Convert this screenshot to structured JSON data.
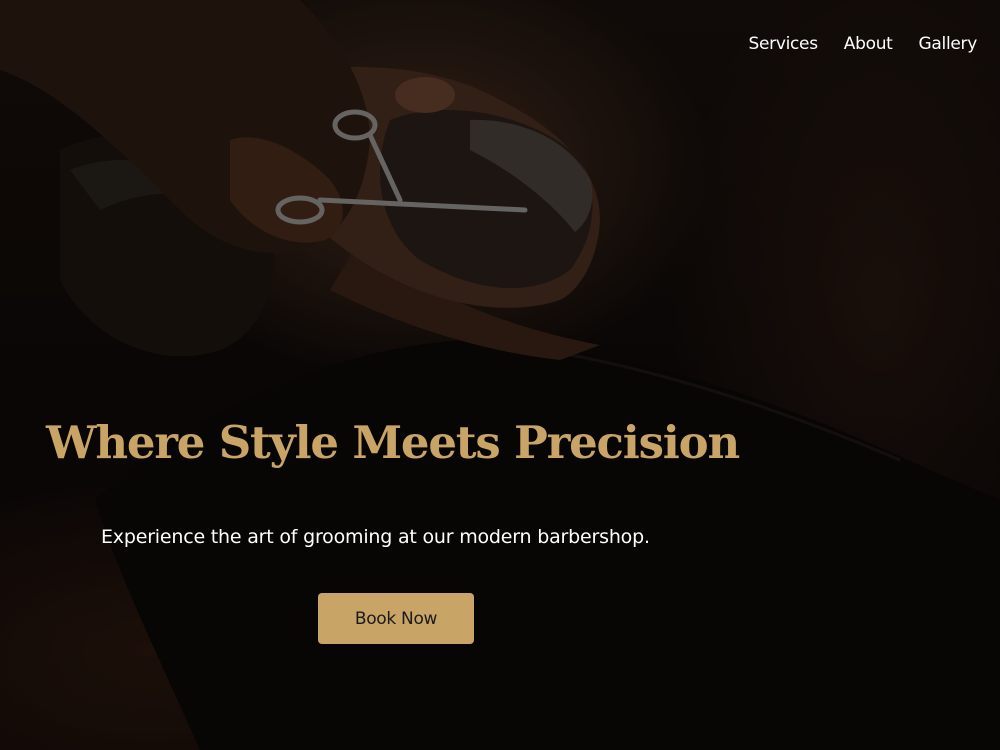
{
  "nav": {
    "items": [
      {
        "label": "Services"
      },
      {
        "label": "About"
      },
      {
        "label": "Gallery"
      }
    ]
  },
  "hero": {
    "headline": "Where Style Meets Precision",
    "subtitle": "Experience the art of grooming at our modern barbershop.",
    "cta_label": "Book Now"
  },
  "colors": {
    "accent": "#c9a467",
    "background": "#0e0a08",
    "text": "#ffffff"
  }
}
